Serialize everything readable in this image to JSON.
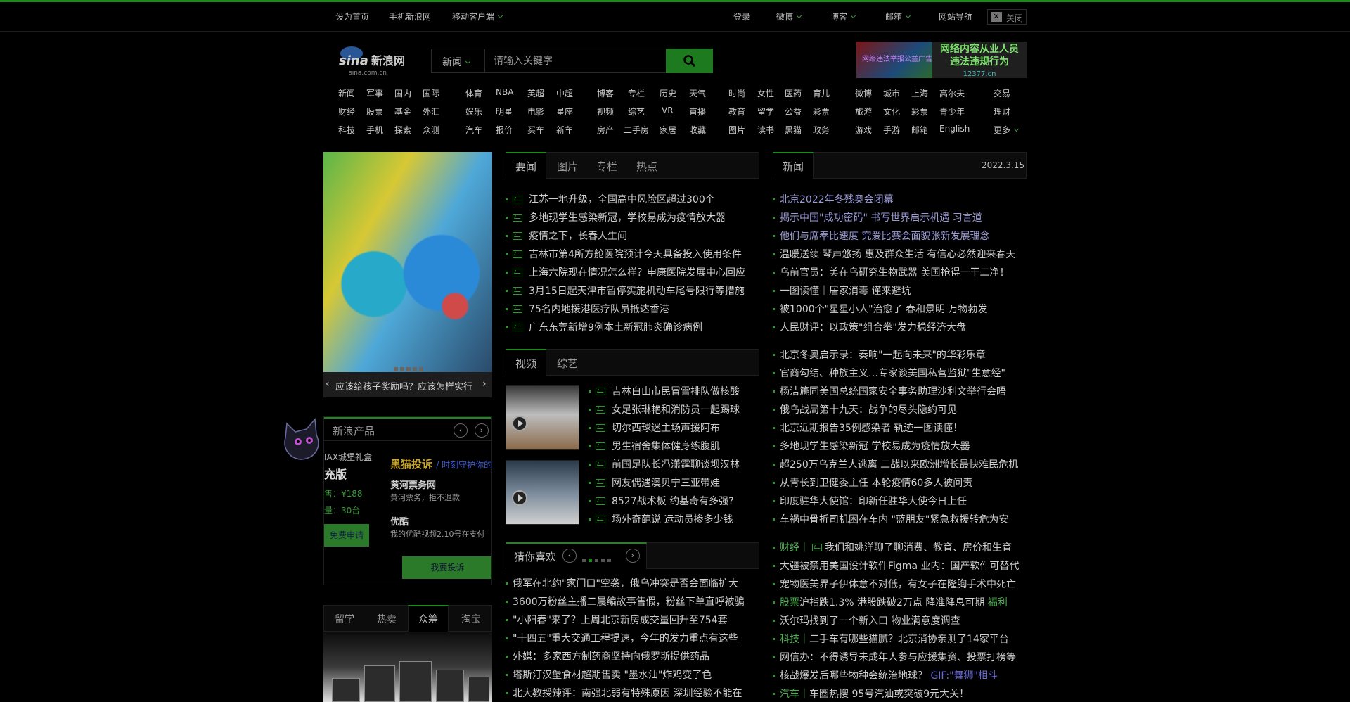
{
  "topbar": {
    "left": [
      "设为首页",
      "手机新浪网",
      "移动客户端"
    ],
    "right": [
      "登录",
      "微博",
      "博客",
      "邮箱",
      "网站导航"
    ],
    "close_label": "关闭"
  },
  "search": {
    "category": "新闻",
    "placeholder": "请输入关键字"
  },
  "logo": {
    "text": "sina新浪网",
    "sub": "sina.com.cn"
  },
  "ad": {
    "left_text": "网络违法举报公益广告",
    "line1": "网络内容从业人员",
    "line2": "违法违规行为",
    "url": "12377.cn"
  },
  "nav": {
    "col1": [
      [
        "新闻",
        "军事",
        "国内",
        "国际"
      ],
      [
        "财经",
        "股票",
        "基金",
        "外汇"
      ],
      [
        "科技",
        "手机",
        "探索",
        "众测"
      ]
    ],
    "col2": [
      [
        "体育",
        "NBA",
        "英超",
        "中超"
      ],
      [
        "娱乐",
        "明星",
        "电影",
        "星座"
      ],
      [
        "汽车",
        "报价",
        "买车",
        "新车"
      ]
    ],
    "col3": [
      [
        "博客",
        "专栏",
        "历史",
        "天气"
      ],
      [
        "视频",
        "综艺",
        "VR",
        "直播"
      ],
      [
        "房产",
        "二手房",
        "家居",
        "收藏"
      ]
    ],
    "col4": [
      [
        "时尚",
        "女性",
        "医药",
        "育儿"
      ],
      [
        "教育",
        "留学",
        "公益",
        "彩票"
      ],
      [
        "图片",
        "读书",
        "黑猫",
        "政务"
      ]
    ],
    "col5": [
      [
        "微博",
        "城市",
        "上海",
        "高尔夫"
      ],
      [
        "旅游",
        "文化",
        "彩票",
        "青少年"
      ],
      [
        "游戏",
        "手游",
        "邮箱",
        "English"
      ]
    ],
    "col6": [
      "交易",
      "理财",
      "更多"
    ]
  },
  "slideshow": {
    "caption": "应该给孩子奖励吗？应该怎样实行",
    "dots": 5
  },
  "products": {
    "title": "新浪产品",
    "left_lines": [
      "IAX城堡礼盒",
      "充版",
      "售：¥188",
      "量：30台",
      "免费申请"
    ],
    "black_cat": "黑猫投诉",
    "black_cat_tag": "时刻守护你的",
    "item1_title": "黄河票务网",
    "item1_desc": "黄河票务，拒不退款",
    "item2_title": "优酷",
    "item2_desc": "我的优酷视频2.10号在支付",
    "complain_btn": "我要投诉"
  },
  "bottom_tabs": [
    "留学",
    "热卖",
    "众筹",
    "淘宝"
  ],
  "bottom_tabs_active": 2,
  "mid_tabs": [
    "要闻",
    "图片",
    "专栏",
    "热点"
  ],
  "mid_news": [
    "江苏一地升级，全国高中风险区超过300个",
    "多地现学生感染新冠，学校易成为疫情放大器",
    "疫情之下，长春人生间",
    "吉林市第4所方舱医院预计今天具备投入使用条件",
    "上海六院现在情况怎么样？申康医院发展中心回应",
    "3月15日起天津市暂停实施机动车尾号限行等措施",
    "75名内地援港医疗队员抵达香港",
    "广东东莞新增9例本土新冠肺炎确诊病例"
  ],
  "video_tabs": [
    "视频",
    "综艺"
  ],
  "video_news": [
    "吉林白山市民冒雪排队做核酸",
    "女足张琳艳和消防员一起踢球",
    "切尔西球迷主场声援阿布",
    "男生宿舍集体健身练腹肌",
    "前国足队长冯潇霆聊谈坝汉林",
    "网友偶遇澳贝宁三亚带娃",
    "8527战术板 约基奇有多强?",
    "场外奇葩说 运动员掺多少钱"
  ],
  "rec_title": "猜你喜欢",
  "rec_news": [
    "俄军在北约\"家门口\"空袭，俄乌冲突是否会面临扩大",
    "3600万粉丝主播二晨编故事售假，粉丝下单直呼被骗",
    "\"小阳春\"来了？上周北京新房成交量回升至754套",
    "\"十四五\"重大交通工程提速，今年的发力重点有这些",
    "外媒：多家西方制药商坚持向俄罗斯提供药品",
    "塔斯汀汉堡食材超期售卖 \"墨水油\"炸鸡变了色",
    "北大教授辣评：南强北弱有特殊原因 深圳经验不能在"
  ],
  "right_title": "新闻",
  "right_date": "2022.3.15",
  "right_news": [
    "北京2022年冬残奥会闭幕",
    "揭示中国\"成功密码\" 书写世界启示机遇 习言道",
    "他们与席奉比速度 究爱比赛会面貌张新发展理念",
    "温暖送续 琴声悠扬 惠及群众生活 有信心必然迎来春天",
    "乌前官员：美在乌研究生物武器 美国抢得一干二净！",
    "一图读懂｜居家消毒 谨来避坑",
    "被1000个\"星星小人\"治愈了 春和景明 万物勃发",
    "人民财评：以政策\"组合拳\"发力稳经济大盘",
    "北京冬奥启示录：奏响\"一起向未来\"的华彩乐章",
    "官商勾结、种族主义…专家谈美国私营监狱\"生意经\"",
    "杨洁篪同美国总统国家安全事务助理沙利文举行会晤",
    "俄乌战局第十九天：战争的尽头隐约可见",
    "北京近期报告35例感染者 轨迹一图读懂！",
    "多地现学生感染新冠 学校易成为疫情放大器",
    "超250万乌克兰人逃离 二战以来欧洲增长最快难民危机",
    "从青长到卫健委主任 本轮疫情60多人被问责",
    "印度驻华大使馆：印新任驻华大使今日上任",
    "车祸中骨折司机困在车内 \"蓝朋友\"紧急救援转危为安"
  ],
  "right_news2": [
    {
      "tag": "财经｜",
      "text": "我们和姚洋聊了聊消费、教育、房价和生育"
    },
    {
      "tag": "",
      "text": "大疆被禁用美国设计软件Figma 业内：国产软件可替代"
    },
    {
      "tag": "",
      "text": "宠物医美界子伊体意不对低，有女子在隆胸手术中死亡"
    },
    {
      "tag": "股票",
      "text": "沪指跌1.3% 港股跌破2万点 降准降息可期",
      "extra": "福利"
    },
    {
      "tag": "",
      "text": "沃尔玛找到了一个新入口 物业满意度调查"
    },
    {
      "tag": "科技｜",
      "text": "二手车有哪些猫腻？北京消协亲测了14家平台"
    },
    {
      "tag": "",
      "text": "网信办：不得诱导未成年人参与应援集资、投票打榜等"
    },
    {
      "tag": "",
      "text": "核战爆发后哪些物种会统治地球？",
      "extra": "GIF:\"舞狮\"相斗"
    },
    {
      "tag": "汽车｜",
      "text": "车圈热搜 95号汽油或突破9元大关！"
    }
  ],
  "colors": {
    "accent": "#1a8a1a",
    "link_green": "#4caf50",
    "bg": "#000000"
  }
}
